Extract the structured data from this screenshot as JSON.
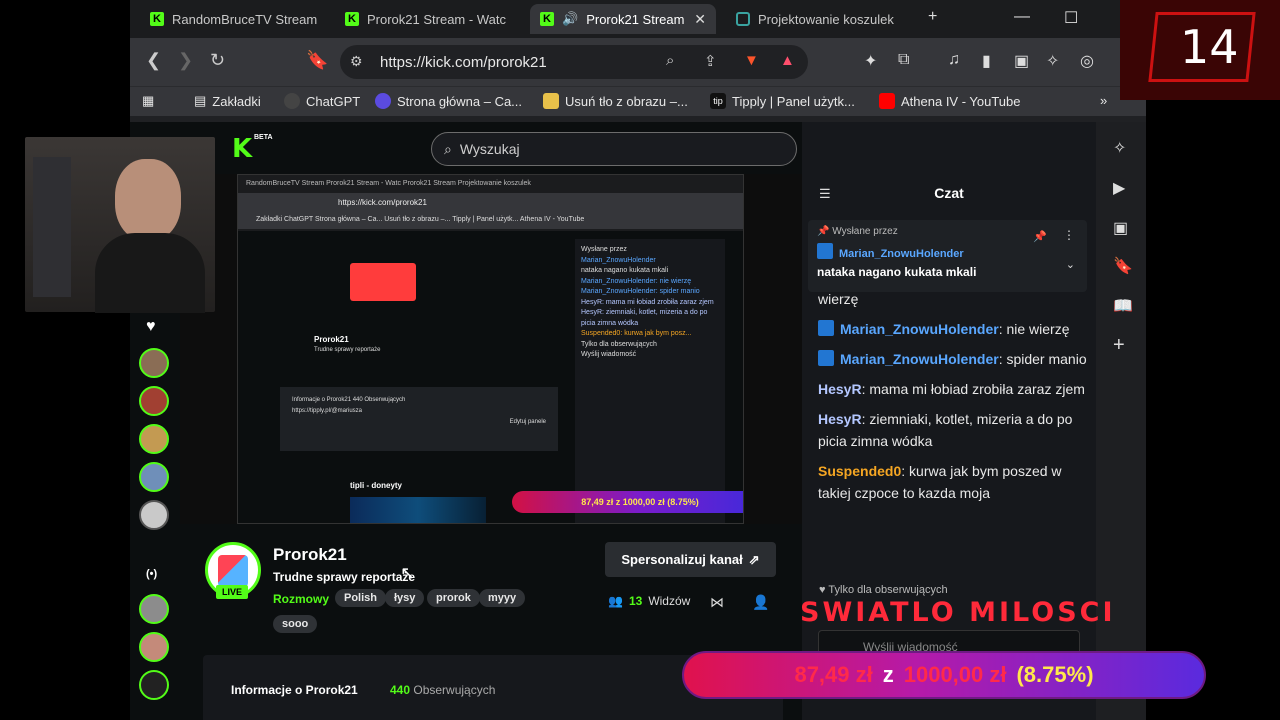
{
  "browser": {
    "tabs": [
      {
        "label": "RandomBruceTV Stream",
        "favicon": "kick-icon"
      },
      {
        "label": "Prorok21 Stream - Watc",
        "favicon": "kick-icon"
      },
      {
        "label": "Prorok21 Stream",
        "favicon": "kick-icon",
        "active": true
      },
      {
        "label": "Projektowanie koszulek",
        "favicon": "shirt-icon"
      }
    ],
    "url": "https://kick.com/prorok21",
    "bookmarks": [
      {
        "label": "Zakładki",
        "icon": "bookmarks-icon"
      },
      {
        "label": "ChatGPT",
        "icon": "chatgpt-icon"
      },
      {
        "label": "Strona główna – Ca...",
        "icon": "canva-icon"
      },
      {
        "label": "Usuń tło z obrazu –...",
        "icon": "removebg-icon"
      },
      {
        "label": "Tipply | Panel użytk...",
        "icon": "tipply-icon"
      },
      {
        "label": "Athena IV - YouTube",
        "icon": "youtube-icon"
      }
    ]
  },
  "kick": {
    "logo": "K",
    "beta": "BETA",
    "search_placeholder": "Wyszukaj",
    "channel": {
      "name": "Prorok21",
      "title": "Trudne sprawy reportaże",
      "category": "Rozmowy",
      "tags": [
        "Polish",
        "łysy",
        "prorok",
        "myyy",
        "sooo"
      ],
      "live": "LIVE",
      "sponsor_button": "Spersonalizuj kanał",
      "viewers_count": "13",
      "viewers_label": "Widzów",
      "about_title": "Informacje o Prorok21",
      "followers_count": "440",
      "followers_label": "Obserwujących"
    },
    "chat": {
      "title": "Czat",
      "pinned_by": "Wysłane przez",
      "pinned_author": "Marian_ZnowuHolender",
      "pinned_message": "nataka nagano kukata mkali",
      "messages": [
        {
          "user": "",
          "text": "wierzę"
        },
        {
          "user": "Marian_ZnowuHolender",
          "text": ": nie wierzę"
        },
        {
          "user": "Marian_ZnowuHolender",
          "text": ": spider manio"
        },
        {
          "user": "HesyR",
          "text": ": mama mi łobiad zrobiła zaraz zjem"
        },
        {
          "user": "HesyR",
          "text": ": ziemniaki, kotlet, mizeria a do po picia zimna wódka"
        },
        {
          "user": "Suspended0",
          "text": ": kurwa jak bym poszed w takiej czpoce to kazda moja"
        }
      ],
      "followers_only": "Tylko dla obserwujących",
      "input_placeholder": "Wyślij wiadomość"
    }
  },
  "overlay": {
    "stream_number": "14",
    "goal_current": "87,49 zł",
    "goal_sep": "z",
    "goal_target": "1000,00 zł",
    "goal_percent": "(8.75%)",
    "goal_fraction": 0.0875,
    "banner": "SWIATLO MILOSCI"
  },
  "inner": {
    "url": "https://kick.com/prorok21",
    "tabs": "RandomBruceTV Stream   Prorok21 Stream - Watc   Prorok21 Stream   Projektowanie koszulek",
    "bookmarks": "Zakładki   ChatGPT   Strona główna – Ca...   Usuń tło z obrazu –...   Tipply | Panel użytk...   Athena IV - YouTube",
    "channel_name": "Prorok21",
    "channel_title": "Trudne sprawy reportaże",
    "about": "Informacje o Prorok21  440 Obserwujących",
    "link": "https://tipply.pl/@mariusza",
    "tipli": "tipli - doneyty",
    "edit": "Edytuj panele",
    "bar": "87,49 zł z 1000,00 zł (8.75%)",
    "chat_lines": [
      "Wysłane przez",
      "Marian_ZnowuHolender",
      "nataka nagano kukata mkali",
      "Marian_ZnowuHolender: nie wierzę",
      "Marian_ZnowuHolender: spider manio",
      "HesyR: mama mi łobiad zrobiła zaraz zjem",
      "HesyR: ziemniaki, kotlet, mizeria a do po picia zimna wódka",
      "Suspended0: kurwa jak bym posz...",
      "Tylko dla obserwujących",
      "Wyślij wiadomość"
    ]
  },
  "colors": {
    "kick_green": "#53fc18",
    "name_blue": "#5aa7ff",
    "orange": "#f5a623"
  }
}
